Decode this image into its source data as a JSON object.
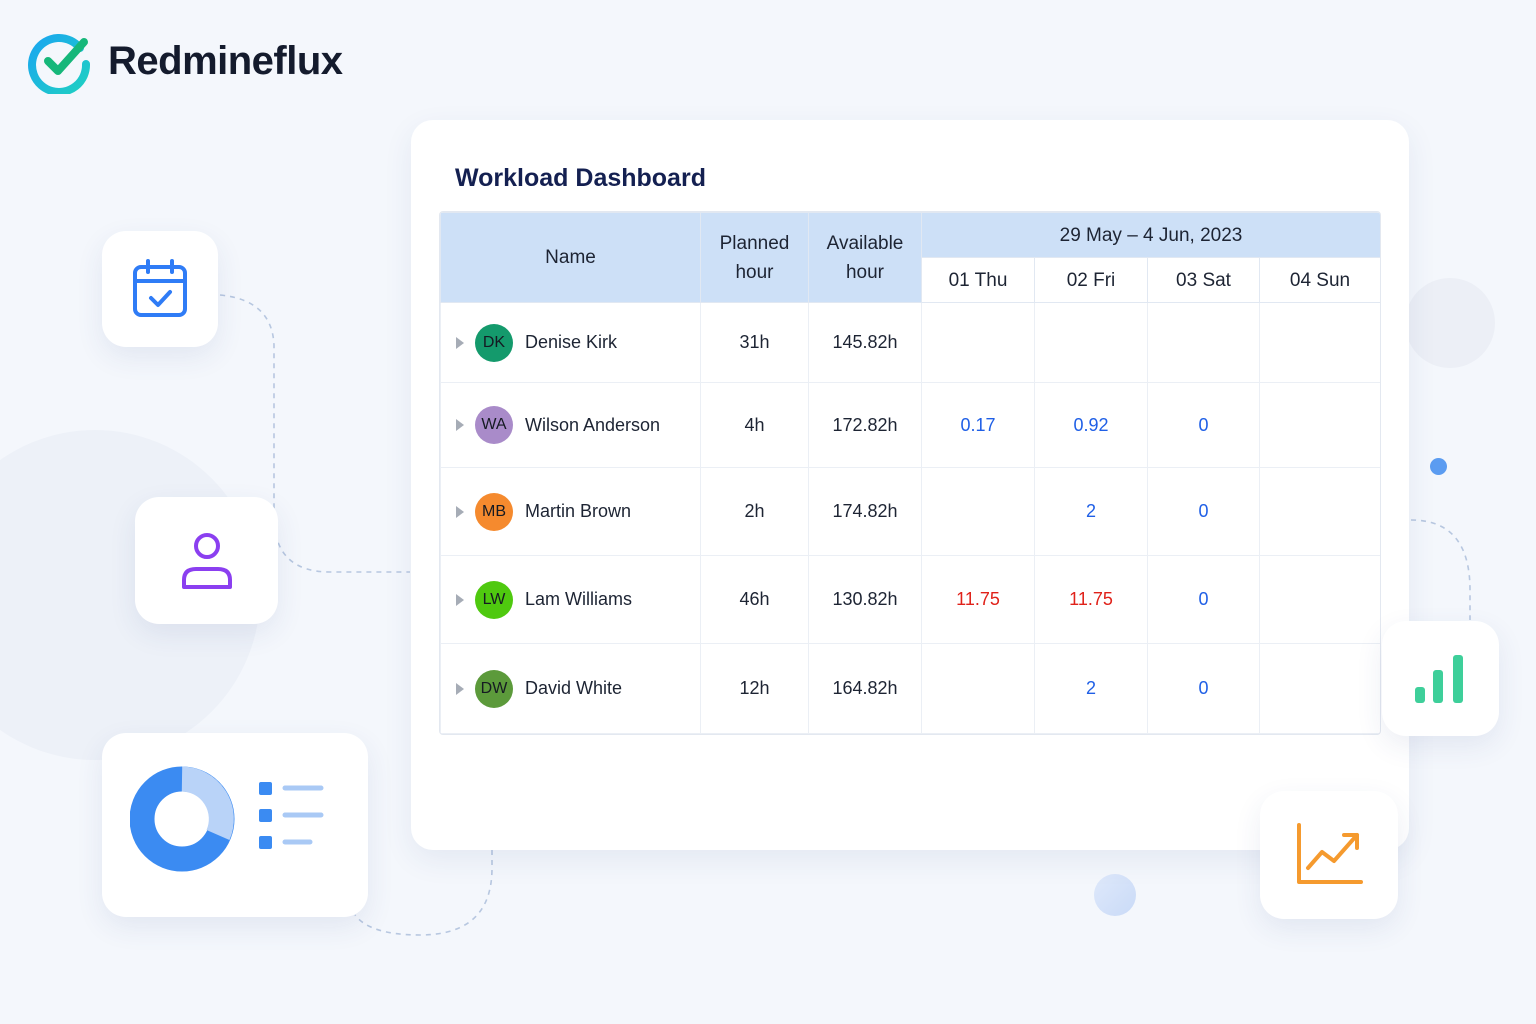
{
  "brand": {
    "name": "Redmineflux",
    "logo_icon": "check-circle-logo-icon"
  },
  "dashboard": {
    "title": "Workload Dashboard",
    "columns": {
      "name": "Name",
      "planned_line1": "Planned",
      "planned_line2": "hour",
      "available_line1": "Available",
      "available_line2": "hour",
      "date_range": "29 May – 4 Jun, 2023",
      "days": [
        "01 Thu",
        "02 Fri",
        "03 Sat",
        "04 Sun"
      ]
    },
    "rows": [
      {
        "initials": "DK",
        "name": "Denise Kirk",
        "planned": "31h",
        "available": "145.82h",
        "days": [
          "",
          "",
          "",
          ""
        ],
        "avatar_color": "#149a6c"
      },
      {
        "initials": "WA",
        "name": "Wilson Anderson",
        "planned": "4h",
        "available": "172.82h",
        "days": [
          "0.17",
          "0.92",
          "0",
          ""
        ],
        "avatar_color": "#a98bc9"
      },
      {
        "initials": "MB",
        "name": "Martin Brown",
        "planned": "2h",
        "available": "174.82h",
        "days": [
          "",
          "2",
          "0",
          ""
        ],
        "avatar_color": "#f58a2e"
      },
      {
        "initials": "LW",
        "name": "Lam Williams",
        "planned": "46h",
        "available": "130.82h",
        "days": [
          "11.75",
          "11.75",
          "0",
          ""
        ],
        "avatar_color": "#4fc90f"
      },
      {
        "initials": "DW",
        "name": "David White",
        "planned": "12h",
        "available": "164.82h",
        "days": [
          "",
          "2",
          "0",
          ""
        ],
        "avatar_color": "#5c9a3b"
      }
    ],
    "value_colors": {
      "under": "#1f5fe6",
      "over": "#e0221a"
    },
    "over_values": [
      "11.75"
    ]
  },
  "decor": {
    "icons": [
      "calendar-check-icon",
      "user-icon",
      "donut-chart-list-icon",
      "bar-chart-icon",
      "trend-up-icon"
    ],
    "colors": {
      "calendar": "#2f7cf6",
      "user": "#8b3ff0",
      "donut": "#3b8bf2",
      "bars": "#3ecf9a",
      "trend": "#f59a2e"
    }
  }
}
